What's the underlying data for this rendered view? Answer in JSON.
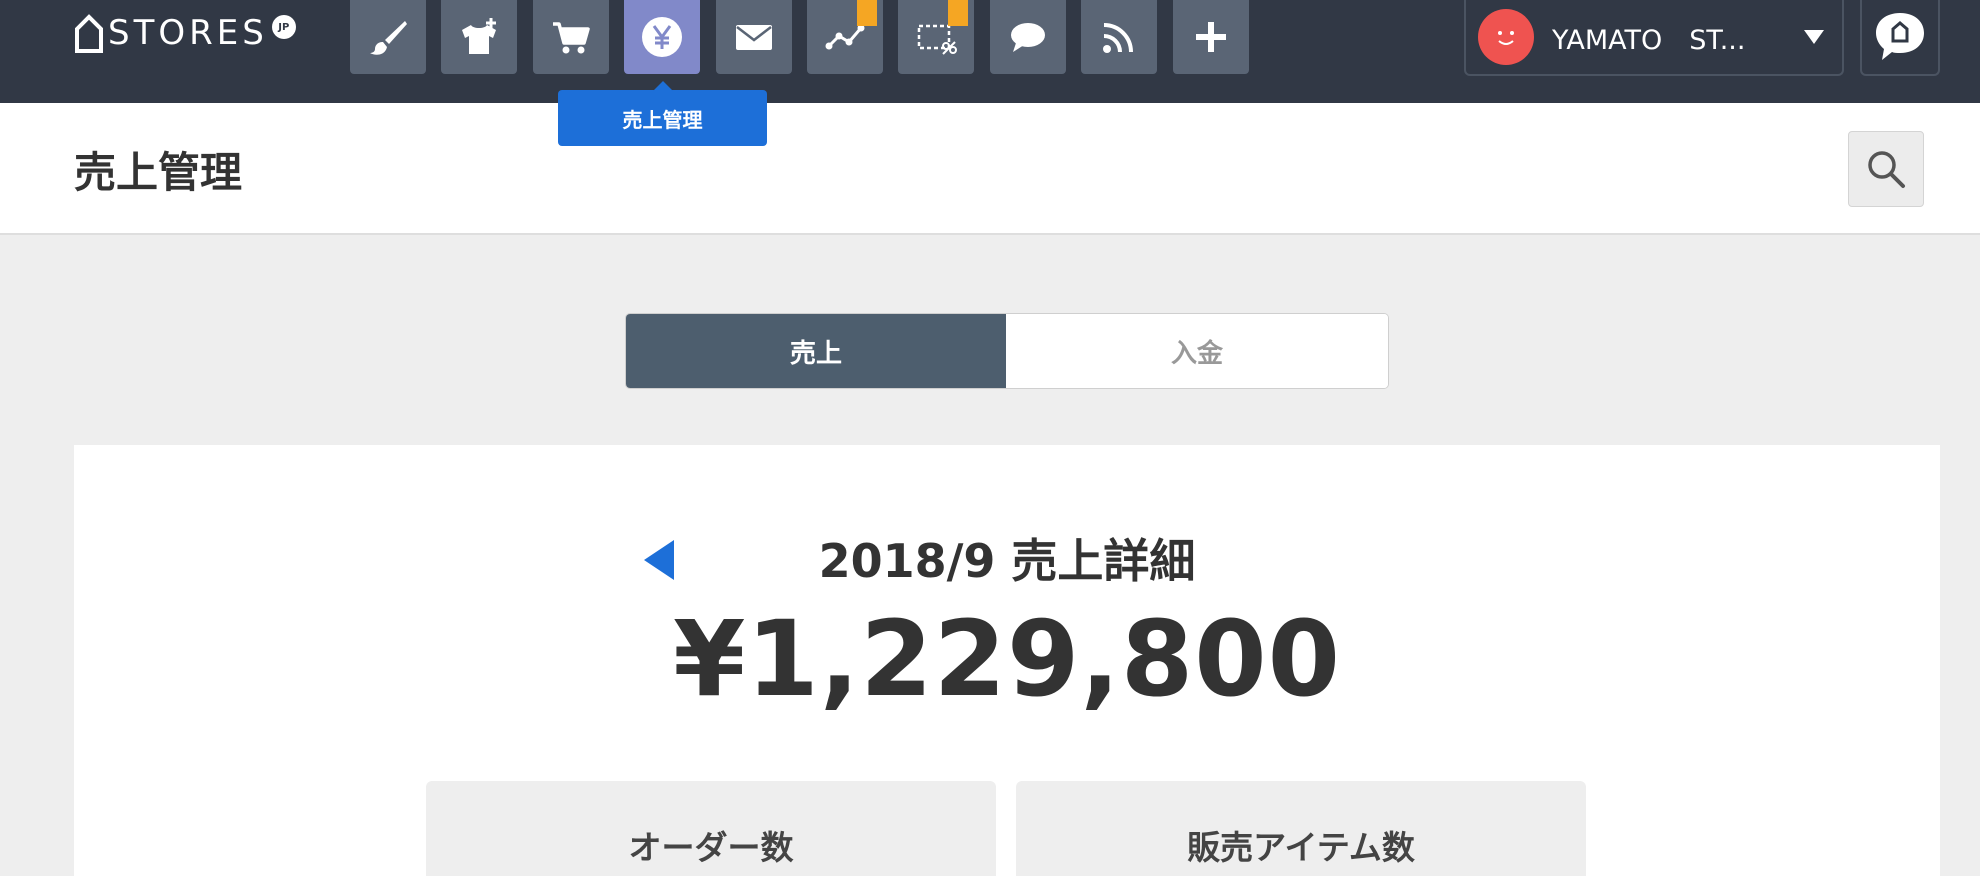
{
  "header": {
    "logo_text": "STORES",
    "logo_suffix": "JP",
    "nav_items": [
      {
        "name": "design",
        "icon": "paintbrush-icon"
      },
      {
        "name": "add-item",
        "icon": "tshirt-plus-icon"
      },
      {
        "name": "orders",
        "icon": "cart-icon"
      },
      {
        "name": "sales",
        "icon": "yen-icon",
        "active": true
      },
      {
        "name": "mail",
        "icon": "envelope-icon"
      },
      {
        "name": "analytics",
        "icon": "line-chart-icon",
        "badge": true
      },
      {
        "name": "coupon",
        "icon": "scissors-coupon-icon",
        "badge": true
      },
      {
        "name": "chat",
        "icon": "speech-bubble-icon"
      },
      {
        "name": "blog",
        "icon": "rss-icon"
      },
      {
        "name": "apps",
        "icon": "plus-icon"
      }
    ],
    "tooltip": "売上管理",
    "user": {
      "name": "YAMATO　ST..."
    }
  },
  "page": {
    "title": "売上管理"
  },
  "tabs": {
    "sales": "売上",
    "deposits": "入金"
  },
  "summary": {
    "period_title": "2018/9 売上詳細",
    "total_amount": "¥1,229,800",
    "stats": {
      "orders_label": "オーダー数",
      "items_label": "販売アイテム数"
    }
  },
  "colors": {
    "topbar": "#313845",
    "nav_button": "#5a6575",
    "nav_active": "#8189c9",
    "badge": "#f5a623",
    "accent_blue": "#1d6fd8",
    "segment_active": "#4d5e6e",
    "avatar": "#ef5350"
  }
}
